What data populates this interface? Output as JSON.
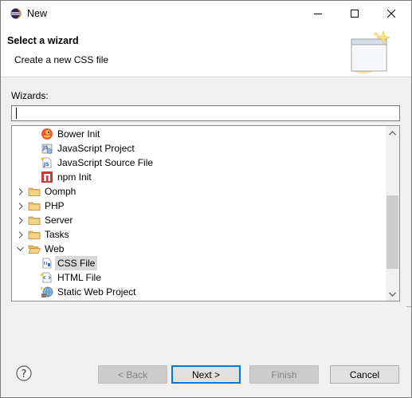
{
  "window": {
    "title": "New"
  },
  "header": {
    "title": "Select a wizard",
    "description": "Create a new CSS file"
  },
  "filter": {
    "label": "Wizards:",
    "value": ""
  },
  "tree": {
    "items": [
      {
        "label": "Bower Init",
        "icon": "bower-icon",
        "level": 2
      },
      {
        "label": "JavaScript Project",
        "icon": "js-project-icon",
        "level": 2
      },
      {
        "label": "JavaScript Source File",
        "icon": "js-source-file-icon",
        "level": 2
      },
      {
        "label": "npm Init",
        "icon": "npm-icon",
        "level": 2
      },
      {
        "label": "Oomph",
        "icon": "folder-icon",
        "level": 1,
        "expanded": false
      },
      {
        "label": "PHP",
        "icon": "folder-icon",
        "level": 1,
        "expanded": false
      },
      {
        "label": "Server",
        "icon": "folder-icon",
        "level": 1,
        "expanded": false
      },
      {
        "label": "Tasks",
        "icon": "folder-icon",
        "level": 1,
        "expanded": false
      },
      {
        "label": "Web",
        "icon": "folder-open-icon",
        "level": 1,
        "expanded": true
      },
      {
        "label": "CSS File",
        "icon": "css-file-icon",
        "level": 2,
        "selected": true
      },
      {
        "label": "HTML File",
        "icon": "html-file-icon",
        "level": 2
      },
      {
        "label": "Static Web Project",
        "icon": "web-project-icon",
        "level": 2
      }
    ]
  },
  "buttons": {
    "back": "< Back",
    "next": "Next >",
    "finish": "Finish",
    "cancel": "Cancel"
  },
  "colors": {
    "default_button_border": "#0078d7",
    "folder": "#dcb04a",
    "selection": "#d9d9d9"
  }
}
